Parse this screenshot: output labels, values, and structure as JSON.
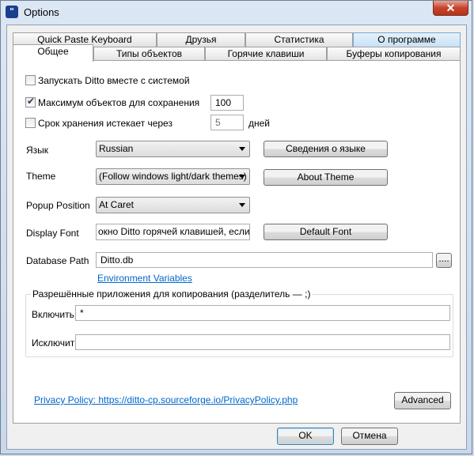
{
  "window": {
    "title": "Options",
    "icon": "ditto-quote-icon",
    "close_glyph": "✕"
  },
  "tabs": {
    "row_back": [
      "Quick Paste Keyboard",
      "Друзья",
      "Статистика",
      "О программе"
    ],
    "row_front": [
      "Общее",
      "Типы объектов",
      "Горячие клавиши",
      "Буферы копирования"
    ],
    "active": "Общее"
  },
  "general": {
    "start_with_system": {
      "label": "Запускать Ditto вместе с системой",
      "checked": false
    },
    "max_items": {
      "label": "Максимум объектов для сохранения",
      "checked": true,
      "value": "100"
    },
    "expire": {
      "label": "Срок хранения истекает через",
      "checked": false,
      "value": "5",
      "unit": "дней"
    },
    "language": {
      "label": "Язык",
      "value": "Russian",
      "button": "Сведения о языке"
    },
    "theme": {
      "label": "Theme",
      "value": "(Follow windows light/dark themes)",
      "button": "About Theme"
    },
    "popup_position": {
      "label": "Popup Position",
      "value": "At Caret"
    },
    "display_font": {
      "label": "Display Font",
      "value": "окно Ditto горячей клавишей, если он",
      "button": "Default Font"
    },
    "database_path": {
      "label": "Database Path",
      "value": "Ditto.db",
      "browse": "....",
      "env_link": "Environment Variables"
    },
    "copy_apps": {
      "title": "Разрешённые приложения для копирования (разделитель — ;)",
      "include_label": "Включить",
      "include_value": "*",
      "exclude_label": "Исключить",
      "exclude_value": ""
    },
    "privacy_link": "Privacy Policy: https://ditto-cp.sourceforge.io/PrivacyPolicy.php",
    "advanced_button": "Advanced"
  },
  "footer": {
    "ok": "OK",
    "cancel": "Отмена"
  },
  "colors": {
    "link": "#0066cc",
    "close_button": "#c7432d",
    "tab_highlight": "#c9e2f7"
  }
}
